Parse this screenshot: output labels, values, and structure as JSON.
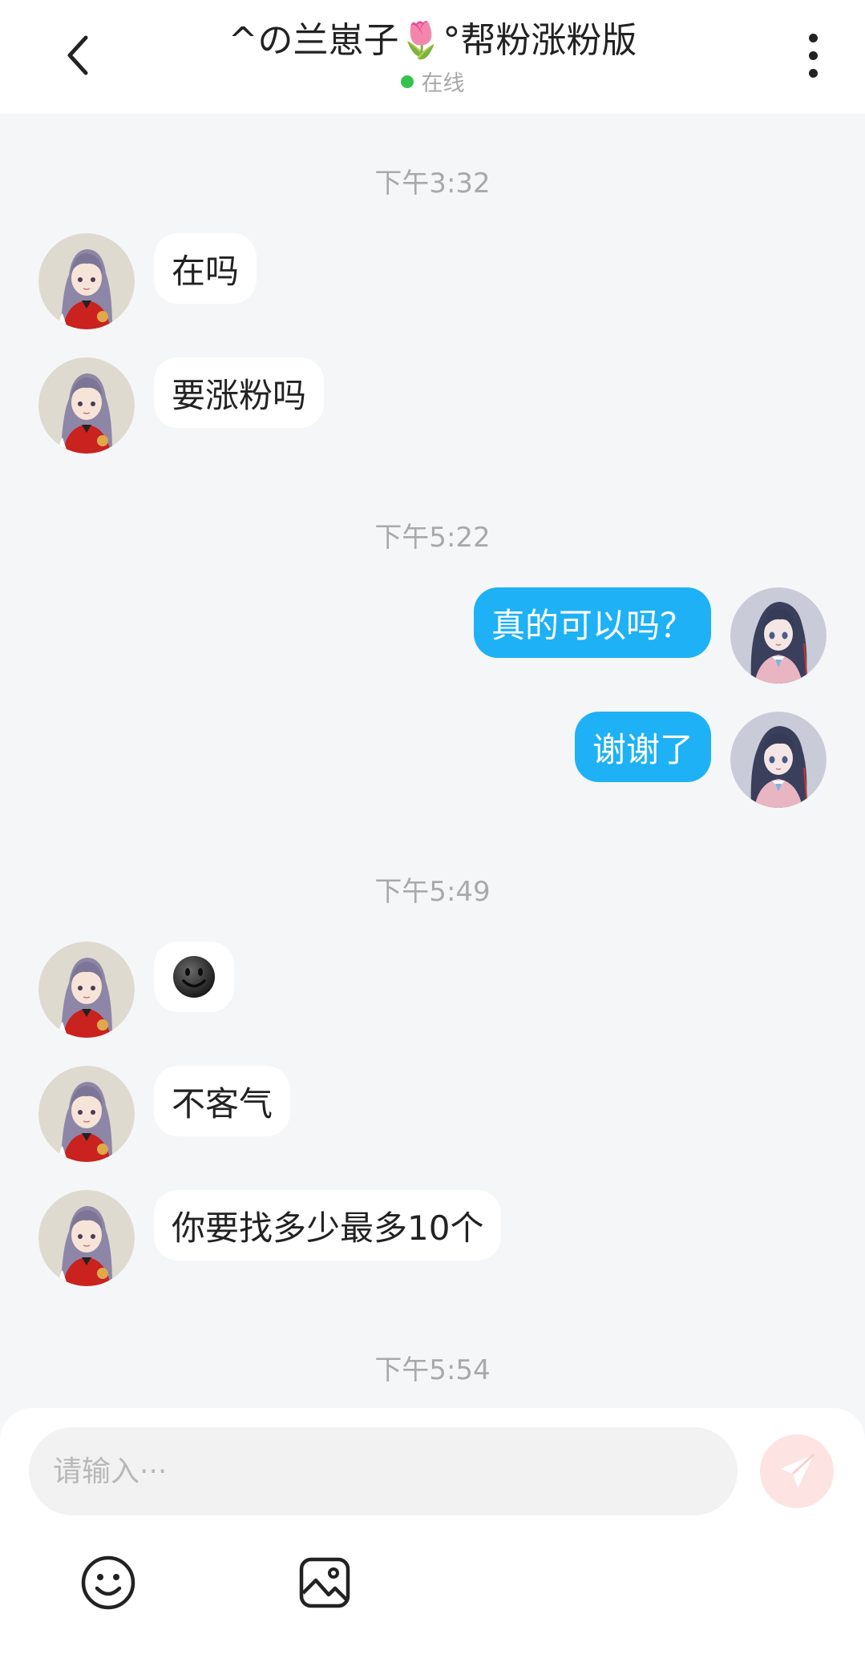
{
  "header": {
    "title": "^の兰崽子🌷°帮粉涨粉版",
    "status": "在线",
    "status_color": "#35c24a"
  },
  "messages": [
    {
      "type": "time",
      "text": "下午3:32"
    },
    {
      "type": "in",
      "text": "在吗"
    },
    {
      "type": "in",
      "text": "要涨粉吗"
    },
    {
      "type": "time",
      "text": "下午5:22"
    },
    {
      "type": "out",
      "text": "真的可以吗？"
    },
    {
      "type": "out",
      "text": "谢谢了"
    },
    {
      "type": "time",
      "text": "下午5:49"
    },
    {
      "type": "in",
      "icon": "dark-smiley-emoji"
    },
    {
      "type": "in",
      "text": "不客气"
    },
    {
      "type": "in",
      "text": "你要找多少最多10个"
    },
    {
      "type": "time",
      "text": "下午5:54"
    }
  ],
  "composer": {
    "placeholder": "请输入···",
    "send_icon": "paper-plane-icon",
    "tools": [
      "smiley-icon",
      "image-icon"
    ]
  },
  "colors": {
    "outgoing_bubble": "#1eb1f5",
    "incoming_bubble": "#ffffff",
    "chat_background": "#f5f6f8",
    "send_button": "#fde3e1"
  }
}
